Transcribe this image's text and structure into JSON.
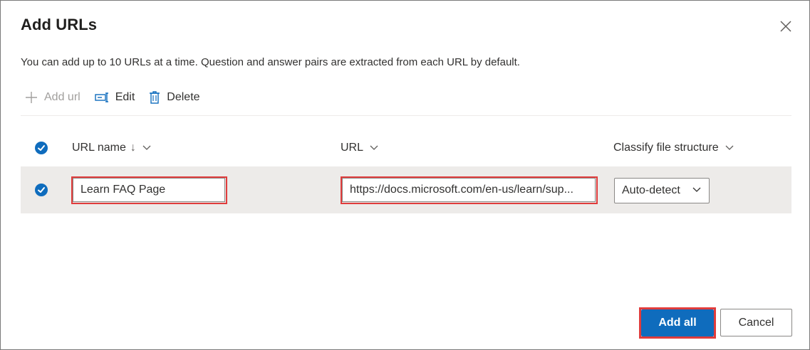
{
  "dialog": {
    "title": "Add URLs",
    "description": "You can add up to 10 URLs at a time. Question and answer pairs are extracted from each URL by default.",
    "close_icon": "close-icon"
  },
  "toolbar": {
    "add_url_label": "Add url",
    "add_url_icon": "plus-icon",
    "edit_label": "Edit",
    "edit_icon": "edit-rename-icon",
    "delete_label": "Delete",
    "delete_icon": "trash-icon"
  },
  "table": {
    "columns": [
      {
        "label": "URL name",
        "sort_indicator": "↓",
        "icon": "chevron-down-icon"
      },
      {
        "label": "URL",
        "icon": "chevron-down-icon"
      },
      {
        "label": "Classify file structure",
        "icon": "chevron-down-icon"
      }
    ],
    "rows": [
      {
        "selected": true,
        "url_name": "Learn FAQ Page",
        "url": "https://docs.microsoft.com/en-us/learn/sup...",
        "classify": "Auto-detect"
      }
    ]
  },
  "footer": {
    "primary_label": "Add all",
    "secondary_label": "Cancel"
  },
  "colors": {
    "accent": "#0f6cbd",
    "highlight": "#e03c3c",
    "row_background": "#edebe9"
  }
}
